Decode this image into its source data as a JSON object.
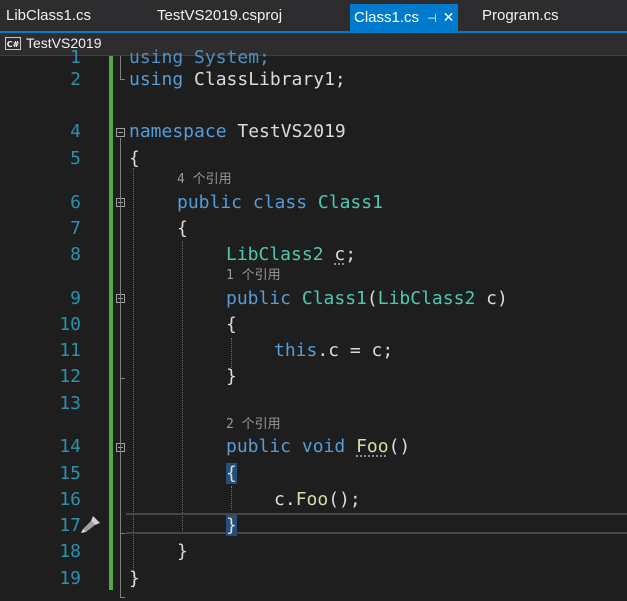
{
  "tabs": [
    {
      "label": "LibClass1.cs"
    },
    {
      "label": "TestVS2019.csproj"
    },
    {
      "label": "Class1.cs",
      "pin": "⊣",
      "close": "✕"
    },
    {
      "label": "Program.cs"
    }
  ],
  "nav": {
    "icon_text": "C#",
    "project": "TestVS2019"
  },
  "code_lens": {
    "class": "4 个引用",
    "ctor": "1 个引用",
    "foo": "2 个引用"
  },
  "lines": {
    "numbers": [
      "1",
      "2",
      "4",
      "5",
      "6",
      "7",
      "8",
      "9",
      "10",
      "11",
      "12",
      "13",
      "14",
      "15",
      "16",
      "17",
      "18",
      "19"
    ]
  },
  "code": {
    "l1": "using System;",
    "l2_kw": "using",
    "l2_rest": " ClassLibrary1;",
    "l4_kw": "namespace",
    "l4_rest": " TestVS2019",
    "l5": "{",
    "l6_kw1": "public",
    "l6_kw2": "class",
    "l6_ty": "Class1",
    "l7": "{",
    "l8_ty": "LibClass2",
    "l8_var": "c",
    "l8_end": ";",
    "l9_kw": "public",
    "l9_ty": "Class1",
    "l9_p1": "(",
    "l9_ty2": "LibClass2",
    "l9_p2": " c)",
    "l10": "{",
    "l11_kw": "this",
    "l11_rest": ".c = c;",
    "l12": "}",
    "l14_kw1": "public",
    "l14_kw2": "void",
    "l14_fn": "Foo",
    "l14_rest": "()",
    "l15": "{",
    "l16_pre": "c.",
    "l16_fn": "Foo",
    "l16_rest": "();",
    "l17": "}",
    "l18": "}",
    "l19": "}"
  },
  "colors": {
    "keyword": "#569cd6",
    "type": "#4ec9b0",
    "method": "#dcdcaa",
    "line_number": "#2b91af",
    "change_bar": "#57a64a",
    "active_tab": "#007acc"
  }
}
